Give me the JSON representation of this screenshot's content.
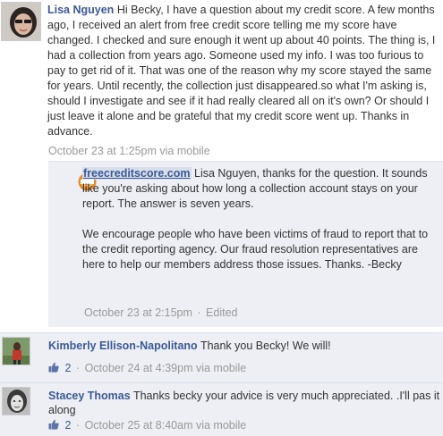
{
  "post": {
    "author": "Lisa Nguyen",
    "body": "Hi Becky, I have a question about my credit score. A few months ago, I received an alert from free credit score telling me my score have changed. I checked and sure enough it went up about 40 points. The thing is, I had a collection from years ago. Someone used my info. I was too furious to pay to get rid of it. That was one of the reason why my score stayed the same for years. Until recently, the collection just disappeared.so what I'm asking is, should I investigate and see if it had really cleared all on it's own? Or should I just leave it alone and be grateful that my credit score went up. Thanks in advance.",
    "timestamp": "October 23 at 1:25pm via mobile"
  },
  "reply": {
    "author": "freecreditscore.com",
    "body_1": "Lisa Nguyen, thanks for the question. It sounds like you're asking about how long a collection account stays on your report. The answer is seven years.",
    "body_2": "We encourage people who have been victims of fraud to report that to the credit reporting agency. Our fraud resolution representatives are here to help our members address those issues. Thanks. -Becky",
    "timestamp": "October 23 at 2:15pm",
    "separator": "·",
    "edited": "Edited"
  },
  "comments": [
    {
      "author": "Kimberly Ellison-Napolitano",
      "body": "Thank you Becky! We will!",
      "likes": "2",
      "separator": "·",
      "timestamp": "October 24 at 4:39pm via mobile"
    },
    {
      "author": "Stacey Thomas",
      "body": "Thanks becky your advice is very much appreciated. .I'll pas it along",
      "likes": "2",
      "separator": "·",
      "timestamp": "October 25 at 8:40am via mobile"
    }
  ],
  "colors": {
    "link": "#3b5998",
    "meta": "#999999",
    "reply_bg": "#edeff4"
  }
}
